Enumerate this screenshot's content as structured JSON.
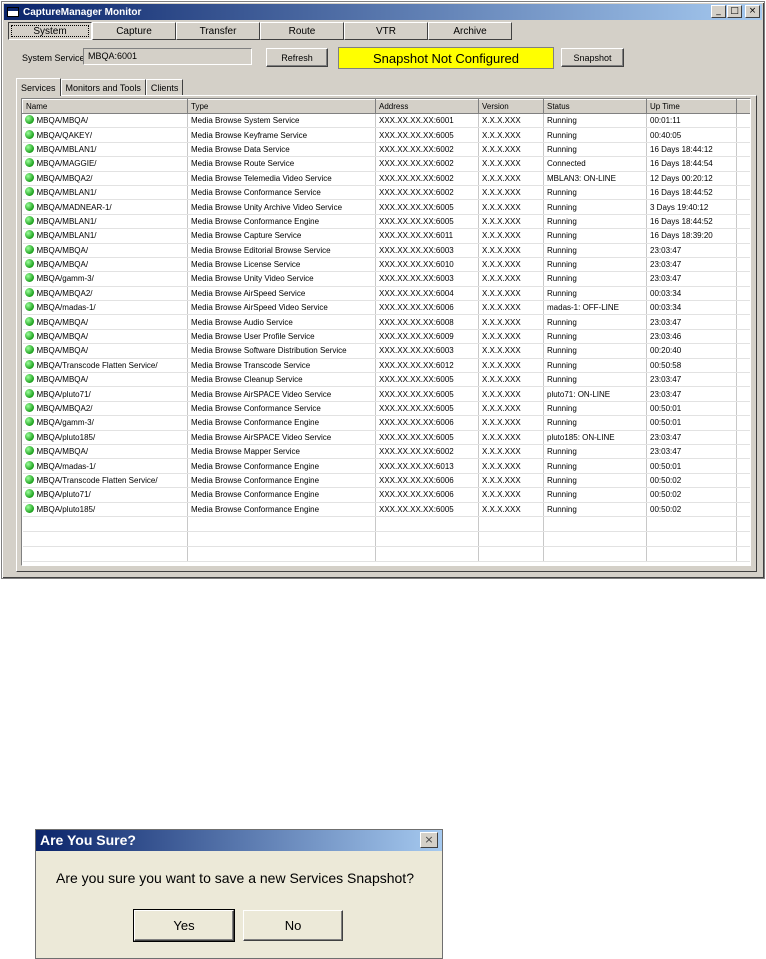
{
  "window": {
    "title": "CaptureManager Monitor",
    "controls": [
      "_",
      "□",
      "×"
    ]
  },
  "top_tabs": [
    "System",
    "Capture",
    "Transfer",
    "Route",
    "VTR",
    "Archive"
  ],
  "system": {
    "service_label": "System Service",
    "service_value": "MBQA:6001",
    "refresh_label": "Refresh",
    "snapshot_status": "Snapshot Not Configured",
    "snapshot_label": "Snapshot"
  },
  "sub_tabs": [
    "Services",
    "Monitors and Tools",
    "Clients"
  ],
  "table": {
    "columns": [
      "Name",
      "Type",
      "Address",
      "Version",
      "Status",
      "Up Time"
    ],
    "rows": [
      [
        "MBQA/MBQA/",
        "Media Browse System Service",
        "XXX.XX.XX.XX:6001",
        "X.X.X.XXX",
        "Running",
        "00:01:11"
      ],
      [
        "MBQA/QAKEY/",
        "Media Browse Keyframe Service",
        "XXX.XX.XX.XX:6005",
        "X.X.X.XXX",
        "Running",
        "00:40:05"
      ],
      [
        "MBQA/MBLAN1/",
        "Media Browse Data Service",
        "XXX.XX.XX.XX:6002",
        "X.X.X.XXX",
        "Running",
        "16 Days 18:44:12"
      ],
      [
        "MBQA/MAGGIE/",
        "Media Browse Route Service",
        "XXX.XX.XX.XX:6002",
        "X.X.X.XXX",
        "Connected",
        "16 Days 18:44:54"
      ],
      [
        "MBQA/MBQA2/",
        "Media Browse Telemedia Video Service",
        "XXX.XX.XX.XX:6002",
        "X.X.X.XXX",
        "MBLAN3: ON-LINE",
        "12 Days 00:20:12"
      ],
      [
        "MBQA/MBLAN1/",
        "Media Browse Conformance Service",
        "XXX.XX.XX.XX:6002",
        "X.X.X.XXX",
        "Running",
        "16 Days 18:44:52"
      ],
      [
        "MBQA/MADNEAR-1/",
        "Media Browse Unity Archive Video Service",
        "XXX.XX.XX.XX:6005",
        "X.X.X.XXX",
        "Running",
        "3 Days 19:40:12"
      ],
      [
        "MBQA/MBLAN1/",
        "Media Browse Conformance Engine",
        "XXX.XX.XX.XX:6005",
        "X.X.X.XXX",
        "Running",
        "16 Days 18:44:52"
      ],
      [
        "MBQA/MBLAN1/",
        "Media Browse Capture Service",
        "XXX.XX.XX.XX:6011",
        "X.X.X.XXX",
        "Running",
        "16 Days 18:39:20"
      ],
      [
        "MBQA/MBQA/",
        "Media Browse Editorial Browse Service",
        "XXX.XX.XX.XX:6003",
        "X.X.X.XXX",
        "Running",
        "23:03:47"
      ],
      [
        "MBQA/MBQA/",
        "Media Browse License Service",
        "XXX.XX.XX.XX:6010",
        "X.X.X.XXX",
        "Running",
        "23:03:47"
      ],
      [
        "MBQA/gamm-3/",
        "Media Browse Unity Video Service",
        "XXX.XX.XX.XX:6003",
        "X.X.X.XXX",
        "Running",
        "23:03:47"
      ],
      [
        "MBQA/MBQA2/",
        "Media Browse AirSpeed Service",
        "XXX.XX.XX.XX:6004",
        "X.X.X.XXX",
        "Running",
        "00:03:34"
      ],
      [
        "MBQA/madas-1/",
        "Media Browse AirSpeed Video Service",
        "XXX.XX.XX.XX:6006",
        "X.X.X.XXX",
        "madas-1: OFF-LINE",
        "00:03:34"
      ],
      [
        "MBQA/MBQA/",
        "Media Browse Audio Service",
        "XXX.XX.XX.XX:6008",
        "X.X.X.XXX",
        "Running",
        "23:03:47"
      ],
      [
        "MBQA/MBQA/",
        "Media Browse User Profile Service",
        "XXX.XX.XX.XX:6009",
        "X.X.X.XXX",
        "Running",
        "23:03:46"
      ],
      [
        "MBQA/MBQA/",
        "Media Browse Software Distribution Service",
        "XXX.XX.XX.XX:6003",
        "X.X.X.XXX",
        "Running",
        "00:20:40"
      ],
      [
        "MBQA/Transcode Flatten Service/",
        "Media Browse Transcode Service",
        "XXX.XX.XX.XX:6012",
        "X.X.X.XXX",
        "Running",
        "00:50:58"
      ],
      [
        "MBQA/MBQA/",
        "Media Browse Cleanup Service",
        "XXX.XX.XX.XX:6005",
        "X.X.X.XXX",
        "Running",
        "23:03:47"
      ],
      [
        "MBQA/pluto71/",
        "Media Browse AirSPACE Video Service",
        "XXX.XX.XX.XX:6005",
        "X.X.X.XXX",
        "pluto71: ON-LINE",
        "23:03:47"
      ],
      [
        "MBQA/MBQA2/",
        "Media Browse Conformance Service",
        "XXX.XX.XX.XX:6005",
        "X.X.X.XXX",
        "Running",
        "00:50:01"
      ],
      [
        "MBQA/gamm-3/",
        "Media Browse Conformance Engine",
        "XXX.XX.XX.XX:6006",
        "X.X.X.XXX",
        "Running",
        "00:50:01"
      ],
      [
        "MBQA/pluto185/",
        "Media Browse AirSPACE Video Service",
        "XXX.XX.XX.XX:6005",
        "X.X.X.XXX",
        "pluto185: ON-LINE",
        "23:03:47"
      ],
      [
        "MBQA/MBQA/",
        "Media Browse Mapper Service",
        "XXX.XX.XX.XX:6002",
        "X.X.X.XXX",
        "Running",
        "23:03:47"
      ],
      [
        "MBQA/madas-1/",
        "Media Browse Conformance Engine",
        "XXX.XX.XX.XX:6013",
        "X.X.X.XXX",
        "Running",
        "00:50:01"
      ],
      [
        "MBQA/Transcode Flatten Service/",
        "Media Browse Conformance Engine",
        "XXX.XX.XX.XX:6006",
        "X.X.X.XXX",
        "Running",
        "00:50:02"
      ],
      [
        "MBQA/pluto71/",
        "Media Browse Conformance Engine",
        "XXX.XX.XX.XX:6006",
        "X.X.X.XXX",
        "Running",
        "00:50:02"
      ],
      [
        "MBQA/pluto185/",
        "Media Browse Conformance Engine",
        "XXX.XX.XX.XX:6005",
        "X.X.X.XXX",
        "Running",
        "00:50:02"
      ]
    ]
  },
  "dialog": {
    "title": "Are You Sure?",
    "close": "×",
    "message": "Are you sure you want to save a new Services Snapshot?",
    "yes_label": "Yes",
    "no_label": "No"
  },
  "colors": {
    "snapshot_status_bg": "#ffff00",
    "status_ok": "#1ca01c",
    "title_bar": "#0a246a"
  }
}
